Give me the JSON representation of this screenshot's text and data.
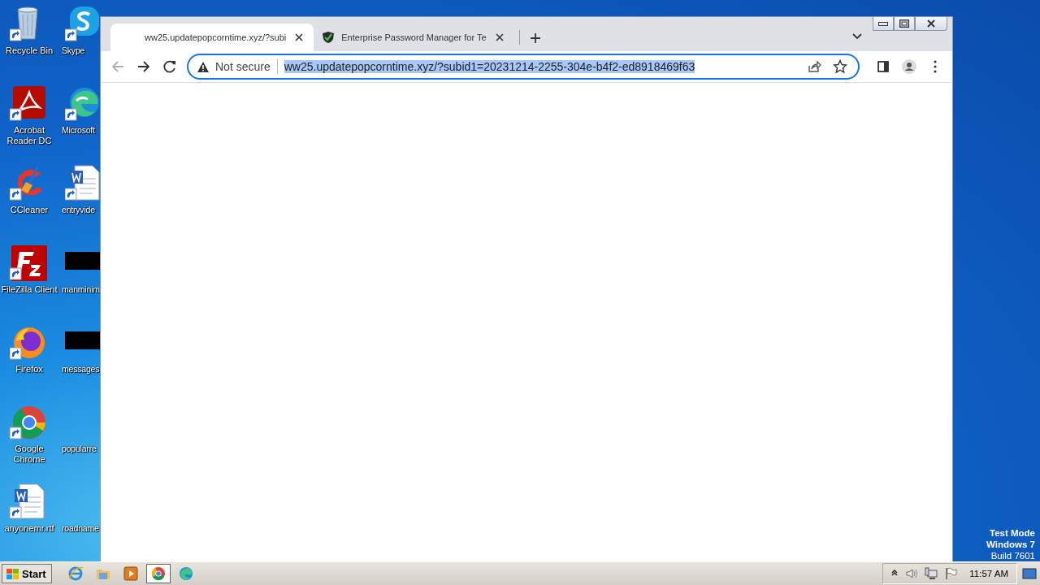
{
  "desktop_icons": [
    {
      "label": "Recycle Bin",
      "kind": "recycle"
    },
    {
      "label": "Skype",
      "kind": "skype"
    },
    {
      "label": "Acrobat Reader DC",
      "kind": "acrobat"
    },
    {
      "label": "Microsoft",
      "kind": "edge"
    },
    {
      "label": "CCleaner",
      "kind": "ccleaner"
    },
    {
      "label": "entryvide",
      "kind": "word"
    },
    {
      "label": "FileZilla Client",
      "kind": "filezilla"
    },
    {
      "label": "manminim",
      "kind": "blank"
    },
    {
      "label": "Firefox",
      "kind": "firefox"
    },
    {
      "label": "messages",
      "kind": "blank"
    },
    {
      "label": "Google Chrome",
      "kind": "chrome"
    },
    {
      "label": "popularre",
      "kind": "none"
    },
    {
      "label": "anyonemr.rtf",
      "kind": "word"
    },
    {
      "label": "roadname",
      "kind": "none"
    }
  ],
  "browser": {
    "tabs": [
      {
        "title": "ww25.updatepopcorntime.xyz/?subi",
        "selected": true,
        "kind": "loading"
      },
      {
        "title": "Enterprise Password Manager for Te",
        "selected": false,
        "kind": "shield"
      }
    ],
    "security_label": "Not secure",
    "url": "ww25.updatepopcorntime.xyz/?subid1=20231214-2255-304e-b4f2-ed8918469f63",
    "url_selected": true
  },
  "test_mode": [
    "Test Mode",
    "Windows 7",
    "Build 7601"
  ],
  "taskbar": {
    "start_label": "Start",
    "apps": [
      {
        "kind": "ie",
        "selected": false
      },
      {
        "kind": "explorer",
        "selected": false
      },
      {
        "kind": "media",
        "selected": false
      },
      {
        "kind": "chrome",
        "selected": true
      },
      {
        "kind": "edge",
        "selected": false
      }
    ],
    "clock": "11:57 AM"
  }
}
